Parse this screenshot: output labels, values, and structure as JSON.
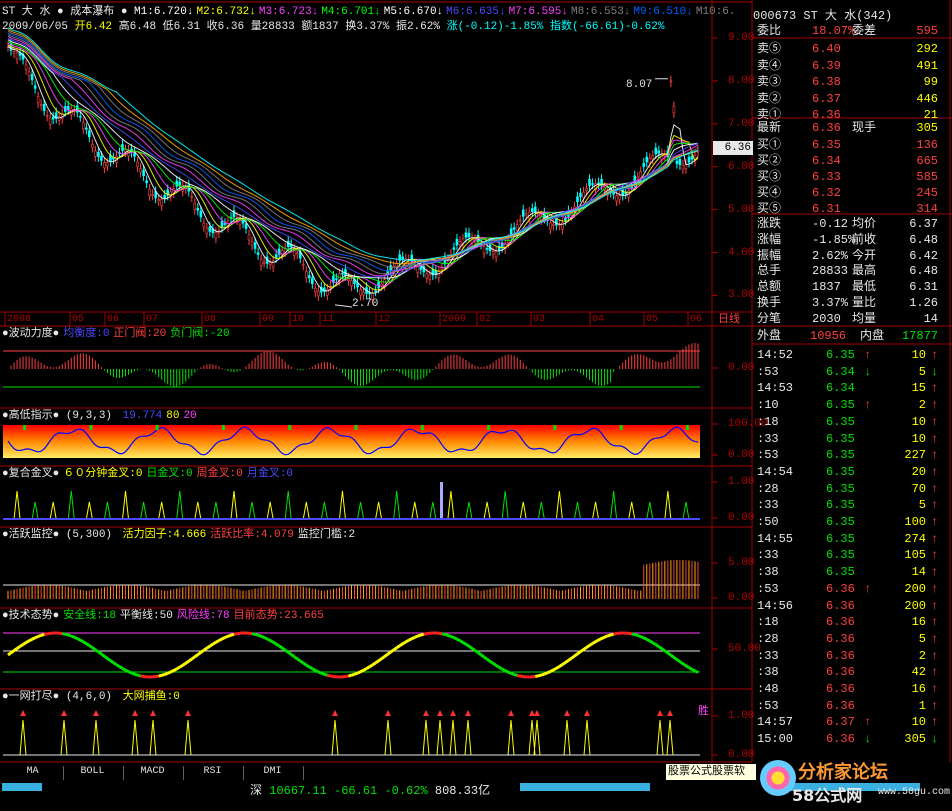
{
  "main": {
    "title_line": {
      "name": "ST 大 水",
      "indicator": "成本瀑布",
      "ma": [
        {
          "k": "M1:6.720",
          "c": "#ffffff"
        },
        {
          "k": "M2:6.732",
          "c": "#ffff00"
        },
        {
          "k": "M3:6.723",
          "c": "#ff40ff"
        },
        {
          "k": "M4:6.701",
          "c": "#00ff00"
        },
        {
          "k": "M5:6.670",
          "c": "#ffffff"
        },
        {
          "k": "M6:6.635",
          "c": "#4a4aff"
        },
        {
          "k": "M7:6.595",
          "c": "#ff40ff"
        },
        {
          "k": "M8:6.553",
          "c": "#808080"
        },
        {
          "k": "M9:6.510",
          "c": "#0060ff"
        },
        {
          "k": "M10:6.",
          "c": "#808080"
        }
      ]
    },
    "info_line": {
      "date": "2009/06/05",
      "open": "开6.42",
      "high": "高6.48",
      "low": "低6.31",
      "close": "收6.36",
      "vol": "量28833",
      "amt": "额1837",
      "turnover": "换3.37%",
      "amp": "振2.62%",
      "chg": "涨(-0.12)-1.85%",
      "index": "指数(-66.61)-0.62%"
    },
    "price_ticks": [
      "9.00",
      "8.00",
      "7.00",
      "6.00",
      "5.00",
      "4.00",
      "3.00"
    ],
    "current_price": "6.36",
    "high_mark": "8.07",
    "low_mark": "2.70",
    "date_ticks": [
      "2008",
      "05",
      "06",
      "07",
      "08",
      "09",
      "10",
      "11",
      "12",
      "2009",
      "02",
      "03",
      "04",
      "05",
      "06"
    ],
    "period_label": "日线"
  },
  "panels": [
    {
      "title": "波动力度",
      "params": "",
      "items": [
        {
          "t": "均衡度:0",
          "c": "#4a4aff"
        },
        {
          "t": "正门阀:20",
          "c": "#ff4040"
        },
        {
          "t": "负门阀:-20",
          "c": "#00e000"
        }
      ],
      "ticks": [
        "0.00"
      ]
    },
    {
      "title": "高低指示",
      "params": "(9,3,3)",
      "items": [
        {
          "t": "19.774",
          "c": "#4a4aff"
        },
        {
          "t": "80",
          "c": "#ffff00"
        },
        {
          "t": "20",
          "c": "#ff40ff"
        }
      ],
      "ticks": [
        "100.00",
        "0.00"
      ]
    },
    {
      "title": "复合金叉",
      "params": "",
      "items": [
        {
          "t": "６０分钟金叉:0",
          "c": "#ffff00"
        },
        {
          "t": "日金叉:0",
          "c": "#00e000"
        },
        {
          "t": "周金叉:0",
          "c": "#ff4040"
        },
        {
          "t": "月金叉:0",
          "c": "#4a4aff"
        }
      ],
      "ticks": [
        "1.00",
        "0.00"
      ]
    },
    {
      "title": "活跃监控",
      "params": "(5,300)",
      "items": [
        {
          "t": "活力因子:4.666",
          "c": "#ffff00"
        },
        {
          "t": "活跃比率:4.079",
          "c": "#ff4040"
        },
        {
          "t": "监控门槛:2",
          "c": "#e8e8e8"
        }
      ],
      "ticks": [
        "5.00",
        "0.00"
      ]
    },
    {
      "title": "技术态势",
      "params": "",
      "items": [
        {
          "t": "安全线:18",
          "c": "#00e000"
        },
        {
          "t": "平衡线:50",
          "c": "#e8e8e8"
        },
        {
          "t": "风险线:78",
          "c": "#ff40ff"
        },
        {
          "t": "目前态势:23.665",
          "c": "#ff4040"
        }
      ],
      "ticks": [
        "50.00"
      ]
    },
    {
      "title": "一网打尽",
      "params": "(4,6,0)",
      "items": [
        {
          "t": "大网捕鱼:0",
          "c": "#ffff00"
        }
      ],
      "ticks": [
        "1.00",
        "0.00"
      ],
      "extra": "胜"
    }
  ],
  "tabs": [
    "MA",
    "BOLL",
    "MACD",
    "RSI",
    "DMI"
  ],
  "status": {
    "market": "深",
    "index": "10667.11",
    "chg": "-66.61",
    "pct": "-0.62%",
    "amount": "808.33亿"
  },
  "banner": "股票公式股票软",
  "watermark": {
    "site": "58公式网",
    "url": "www.58gu.com",
    "forum": "分析家论坛"
  },
  "quote": {
    "header": {
      "code": "000673",
      "name": "ST 大 水",
      "num": "(342)"
    },
    "weibi": {
      "label": "委比",
      "value": "18.07%",
      "label2": "委差",
      "value2": "595"
    },
    "sells": [
      {
        "l": "卖⑤",
        "p": "6.40",
        "v": "292"
      },
      {
        "l": "卖④",
        "p": "6.39",
        "v": "491"
      },
      {
        "l": "卖③",
        "p": "6.38",
        "v": "99"
      },
      {
        "l": "卖②",
        "p": "6.37",
        "v": "446"
      },
      {
        "l": "卖①",
        "p": "6.36",
        "v": "21"
      }
    ],
    "latest": {
      "l": "最新",
      "p": "6.36",
      "l2": "现手",
      "v": "305"
    },
    "buys": [
      {
        "l": "买①",
        "p": "6.35",
        "v": "136"
      },
      {
        "l": "买②",
        "p": "6.34",
        "v": "665"
      },
      {
        "l": "买③",
        "p": "6.33",
        "v": "585"
      },
      {
        "l": "买④",
        "p": "6.32",
        "v": "245"
      },
      {
        "l": "买⑤",
        "p": "6.31",
        "v": "314"
      }
    ],
    "stats": [
      {
        "a": "涨跌",
        "av": "-0.12",
        "b": "均价",
        "bv": "6.37"
      },
      {
        "a": "涨幅",
        "av": "-1.85%",
        "b": "前收",
        "bv": "6.48"
      },
      {
        "a": "振幅",
        "av": "2.62%",
        "b": "今开",
        "bv": "6.42"
      },
      {
        "a": "总手",
        "av": "28833",
        "b": "最高",
        "bv": "6.48"
      },
      {
        "a": "总额",
        "av": "1837",
        "b": "最低",
        "bv": "6.31"
      },
      {
        "a": "换手",
        "av": "3.37%",
        "b": "量比",
        "bv": "1.26"
      },
      {
        "a": "分笔",
        "av": "2030",
        "b": "均量",
        "bv": "14"
      }
    ],
    "waipan": {
      "l": "外盘",
      "v": "10956",
      "l2": "内盘",
      "v2": "17877"
    },
    "ticks": [
      {
        "t": "14:52",
        "p": "6.35",
        "a": "up",
        "v": "10"
      },
      {
        "t": ":53",
        "p": "6.34",
        "a": "dn",
        "v": "5"
      },
      {
        "t": "14:53",
        "p": "6.34",
        "a": "",
        "v": "15"
      },
      {
        "t": ":10",
        "p": "6.35",
        "a": "up",
        "v": "2"
      },
      {
        "t": ":18",
        "p": "6.35",
        "a": "",
        "v": "10"
      },
      {
        "t": ":33",
        "p": "6.35",
        "a": "",
        "v": "10"
      },
      {
        "t": ":53",
        "p": "6.35",
        "a": "",
        "v": "227"
      },
      {
        "t": "14:54",
        "p": "6.35",
        "a": "",
        "v": "20"
      },
      {
        "t": ":28",
        "p": "6.35",
        "a": "",
        "v": "70"
      },
      {
        "t": ":33",
        "p": "6.35",
        "a": "",
        "v": "5"
      },
      {
        "t": ":50",
        "p": "6.35",
        "a": "",
        "v": "100"
      },
      {
        "t": "14:55",
        "p": "6.35",
        "a": "",
        "v": "274"
      },
      {
        "t": ":33",
        "p": "6.35",
        "a": "",
        "v": "105"
      },
      {
        "t": ":38",
        "p": "6.35",
        "a": "",
        "v": "14"
      },
      {
        "t": ":53",
        "p": "6.36",
        "a": "up",
        "v": "200"
      },
      {
        "t": "14:56",
        "p": "6.36",
        "a": "",
        "v": "200"
      },
      {
        "t": ":18",
        "p": "6.36",
        "a": "",
        "v": "16"
      },
      {
        "t": ":28",
        "p": "6.36",
        "a": "",
        "v": "5"
      },
      {
        "t": ":33",
        "p": "6.36",
        "a": "",
        "v": "2"
      },
      {
        "t": ":38",
        "p": "6.36",
        "a": "",
        "v": "42"
      },
      {
        "t": ":48",
        "p": "6.36",
        "a": "",
        "v": "16"
      },
      {
        "t": ":53",
        "p": "6.36",
        "a": "",
        "v": "1"
      },
      {
        "t": "14:57",
        "p": "6.37",
        "a": "up",
        "v": "10"
      },
      {
        "t": "15:00",
        "p": "6.36",
        "a": "dn",
        "v": "305"
      }
    ]
  }
}
